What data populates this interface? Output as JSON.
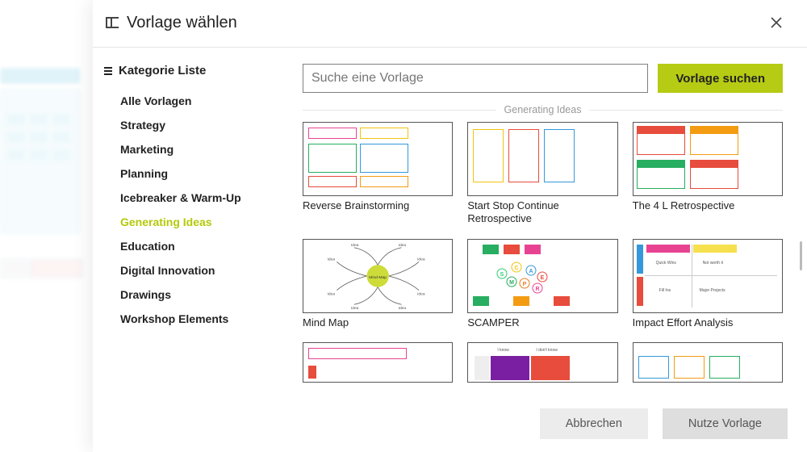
{
  "dialog": {
    "title": "Vorlage wählen"
  },
  "sidebar": {
    "title": "Kategorie Liste",
    "items": [
      {
        "label": "Alle Vorlagen",
        "active": false
      },
      {
        "label": "Strategy",
        "active": false
      },
      {
        "label": "Marketing",
        "active": false
      },
      {
        "label": "Planning",
        "active": false
      },
      {
        "label": "Icebreaker & Warm-Up",
        "active": false
      },
      {
        "label": "Generating Ideas",
        "active": true
      },
      {
        "label": "Education",
        "active": false
      },
      {
        "label": "Digital Innovation",
        "active": false
      },
      {
        "label": "Drawings",
        "active": false
      },
      {
        "label": "Workshop Elements",
        "active": false
      }
    ]
  },
  "search": {
    "placeholder": "Suche eine Vorlage",
    "button": "Vorlage suchen"
  },
  "section_title": "Generating Ideas",
  "templates": [
    {
      "label": "Reverse Brainstorming"
    },
    {
      "label": "Start Stop Continue Retrospective"
    },
    {
      "label": "The 4 L Retrospective"
    },
    {
      "label": "Mind Map"
    },
    {
      "label": "SCAMPER"
    },
    {
      "label": "Impact Effort Analysis"
    },
    {
      "label": ""
    },
    {
      "label": ""
    },
    {
      "label": ""
    }
  ],
  "footer": {
    "cancel": "Abbrechen",
    "use": "Nutze Vorlage"
  }
}
